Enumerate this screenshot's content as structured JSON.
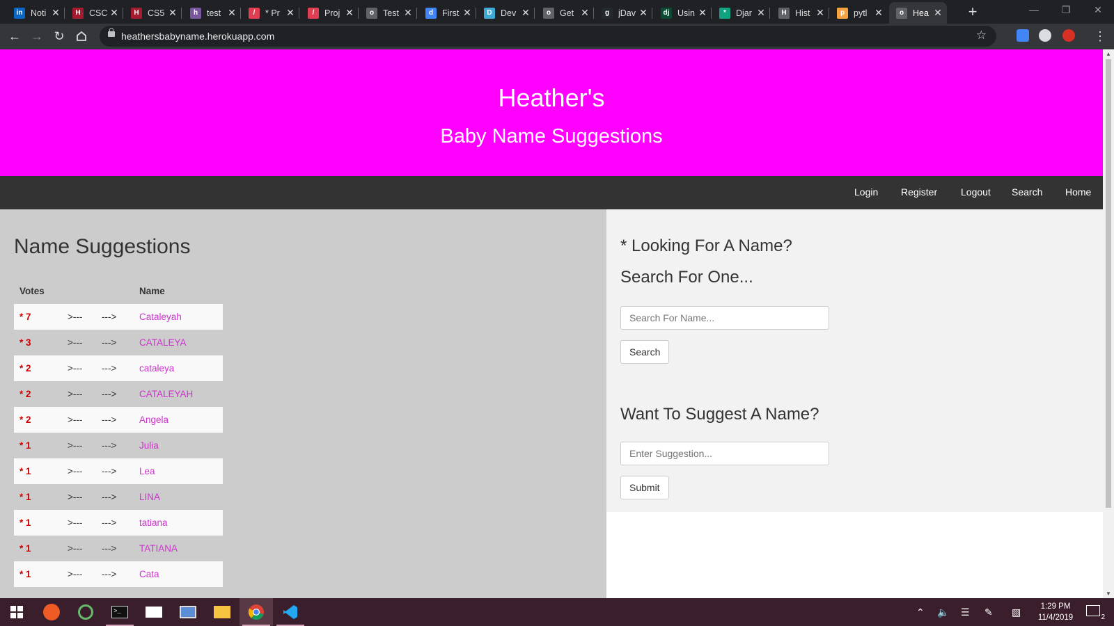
{
  "browser": {
    "tabs": [
      {
        "title": "Noti",
        "icon": "linkedin-icon",
        "color": "#0a66c2",
        "glyph": "in"
      },
      {
        "title": "CSC",
        "icon": "harvard-icon",
        "color": "#a51c30",
        "glyph": "H"
      },
      {
        "title": "CS5",
        "icon": "harvard-shield-icon",
        "color": "#a51c30",
        "glyph": "H"
      },
      {
        "title": "test",
        "icon": "heroku-icon",
        "color": "#79589f",
        "glyph": "h"
      },
      {
        "title": "* Pr",
        "icon": "pen-icon",
        "color": "#e03e52",
        "glyph": "/"
      },
      {
        "title": "Proj",
        "icon": "pen-icon",
        "color": "#e03e52",
        "glyph": "/"
      },
      {
        "title": "Test",
        "icon": "globe-icon",
        "color": "#5f6368",
        "glyph": "o"
      },
      {
        "title": "First",
        "icon": "doc-icon",
        "color": "#4285f4",
        "glyph": "d"
      },
      {
        "title": "Dev",
        "icon": "box-icon",
        "color": "#3fa9d5",
        "glyph": "D"
      },
      {
        "title": "Get",
        "icon": "globe-icon",
        "color": "#5f6368",
        "glyph": "o"
      },
      {
        "title": "jDav",
        "icon": "github-icon",
        "color": "#24292e",
        "glyph": "g"
      },
      {
        "title": "Usin",
        "icon": "django-icon",
        "color": "#0c4b33",
        "glyph": "dj"
      },
      {
        "title": "Djar",
        "icon": "openai-icon",
        "color": "#10a37f",
        "glyph": "*"
      },
      {
        "title": "Hist",
        "icon": "history-icon",
        "color": "#5f6368",
        "glyph": "H"
      },
      {
        "title": "pytl",
        "icon": "python-icon",
        "color": "#f4a340",
        "glyph": "p"
      },
      {
        "title": "Hea",
        "icon": "globe-icon",
        "color": "#5f6368",
        "glyph": "o"
      }
    ],
    "url": "heathersbabyname.herokuapp.com"
  },
  "header": {
    "title": "Heather's",
    "subtitle": "Baby Name Suggestions"
  },
  "nav": {
    "login": "Login",
    "register": "Register",
    "logout": "Logout",
    "search": "Search",
    "home": "Home"
  },
  "suggestions": {
    "heading": "Name Suggestions",
    "col_votes": "Votes",
    "col_name": "Name",
    "arrow_left": ">---",
    "arrow_right": "--->",
    "rows": [
      {
        "votes": "* 7",
        "name": "Cataleyah"
      },
      {
        "votes": "* 3",
        "name": "CATALEYA"
      },
      {
        "votes": "* 2",
        "name": "cataleya"
      },
      {
        "votes": "* 2",
        "name": "CATALEYAH"
      },
      {
        "votes": "* 2",
        "name": "Angela"
      },
      {
        "votes": "* 1",
        "name": "Julia"
      },
      {
        "votes": "* 1",
        "name": "Lea"
      },
      {
        "votes": "* 1",
        "name": "LINA"
      },
      {
        "votes": "* 1",
        "name": "tatiana"
      },
      {
        "votes": "* 1",
        "name": "TATIANA"
      },
      {
        "votes": "* 1",
        "name": "Cata"
      }
    ]
  },
  "search": {
    "title_line1": "* Looking For A Name?",
    "title_line2": "Search For One...",
    "placeholder": "Search For Name...",
    "button": "Search"
  },
  "suggest": {
    "title": "Want To Suggest A Name?",
    "placeholder": "Enter Suggestion...",
    "button": "Submit"
  },
  "taskbar": {
    "time": "1:29 PM",
    "date": "11/4/2019",
    "notifications": "2"
  },
  "colors": {
    "hero": "#ff00ff",
    "navbar": "#333333",
    "vote": "#cc0000",
    "name_link": "#cc33cc"
  }
}
